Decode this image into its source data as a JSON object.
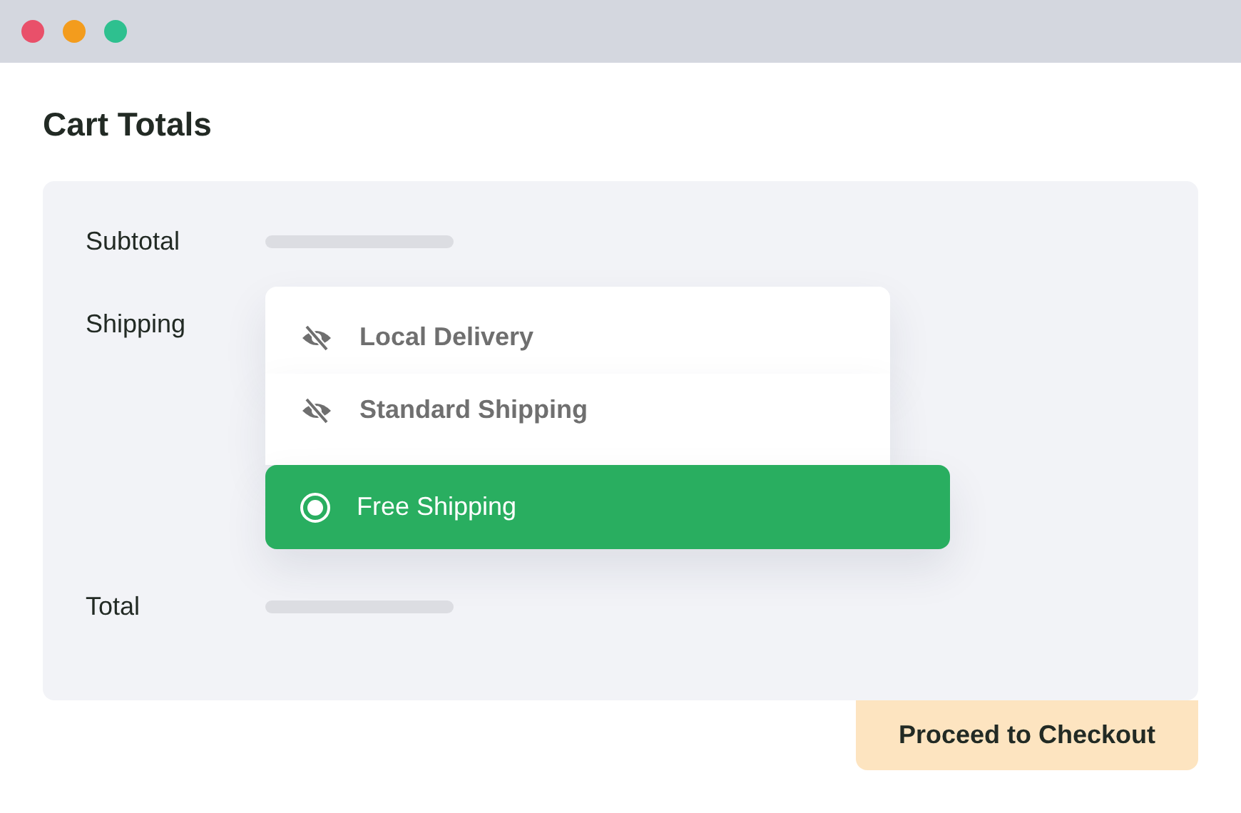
{
  "window": {
    "controls": [
      {
        "color": "#e9506a"
      },
      {
        "color": "#f39c1d"
      },
      {
        "color": "#2ec08f"
      }
    ]
  },
  "title": "Cart Totals",
  "rows": [
    {
      "kind": "placeholder",
      "label": "Subtotal"
    },
    {
      "kind": "options",
      "label": "Shipping",
      "options": [
        {
          "label": "Local Delivery",
          "selected": false
        },
        {
          "label": "Standard Shipping",
          "selected": false
        },
        {
          "label": "Free Shipping",
          "selected": true
        }
      ]
    },
    {
      "kind": "placeholder",
      "label": "Total"
    }
  ],
  "checkout_button": "Proceed to Checkout"
}
